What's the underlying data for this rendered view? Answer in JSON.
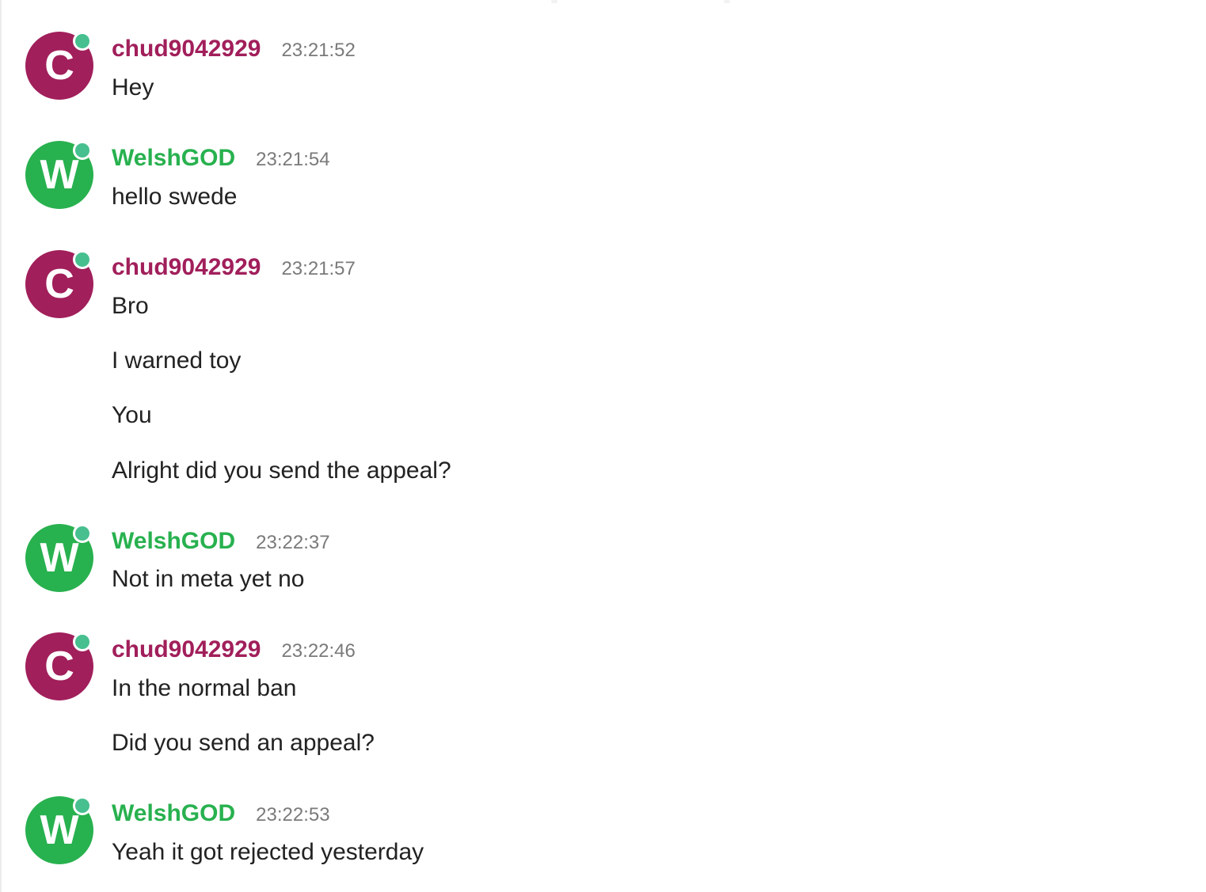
{
  "colors": {
    "chud": "#a11f5b",
    "welsh": "#28b14f",
    "presence": "#47bf8f",
    "timestamp": "#7a7a7a",
    "text": "#222222"
  },
  "messages": [
    {
      "user": "chud9042929",
      "initial": "C",
      "time": "23:21:52",
      "lines": [
        "Hey"
      ]
    },
    {
      "user": "WelshGOD",
      "initial": "W",
      "time": "23:21:54",
      "lines": [
        "hello swede"
      ]
    },
    {
      "user": "chud9042929",
      "initial": "C",
      "time": "23:21:57",
      "lines": [
        "Bro",
        "I warned toy",
        "You",
        "Alright did you send the appeal?"
      ]
    },
    {
      "user": "WelshGOD",
      "initial": "W",
      "time": "23:22:37",
      "lines": [
        "Not in meta yet no"
      ]
    },
    {
      "user": "chud9042929",
      "initial": "C",
      "time": "23:22:46",
      "lines": [
        "In the normal ban",
        "Did you send an appeal?"
      ]
    },
    {
      "user": "WelshGOD",
      "initial": "W",
      "time": "23:22:53",
      "lines": [
        "Yeah it got rejected yesterday"
      ]
    }
  ]
}
